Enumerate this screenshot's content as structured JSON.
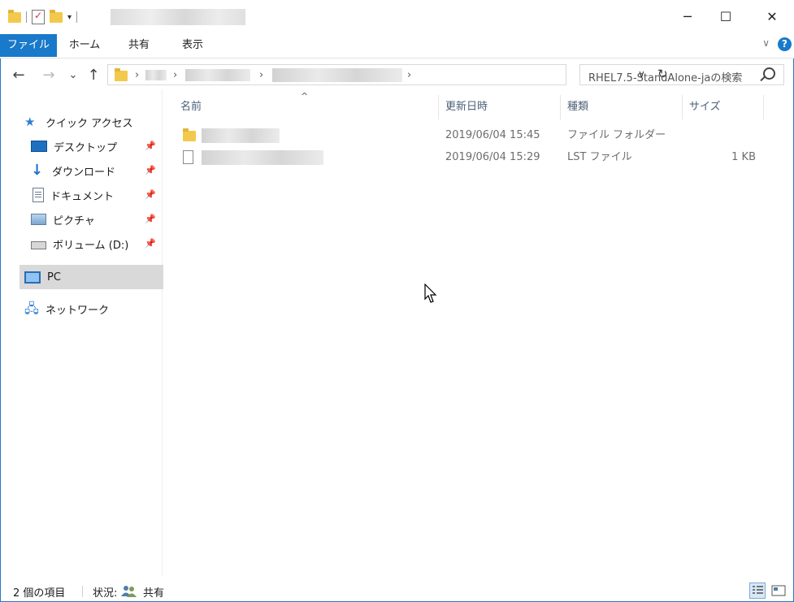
{
  "title_bar": {
    "quick_access_dropdown": "▾",
    "minimize_glyph": "─",
    "maximize_glyph": "☐",
    "close_glyph": "✕"
  },
  "ribbon": {
    "tabs": [
      {
        "label": "ファイル",
        "active": true
      },
      {
        "label": "ホーム",
        "active": false
      },
      {
        "label": "共有",
        "active": false
      },
      {
        "label": "表示",
        "active": false
      }
    ],
    "expand_glyph": "∨",
    "help_glyph": "?"
  },
  "navigation": {
    "back_glyph": "←",
    "forward_glyph": "→",
    "recent_glyph": "⌄",
    "up_glyph": "↑",
    "breadcrumb_chevron": "›",
    "address_dropdown_glyph": "∨",
    "refresh_glyph": "↻",
    "search_placeholder": "RHEL7.5-StandAlone-jaの検索"
  },
  "sidebar": {
    "quick_access_label": "クイック アクセス",
    "pinned_items": [
      {
        "label": "デスクトップ",
        "icon": "desktop-icon"
      },
      {
        "label": "ダウンロード",
        "icon": "download-icon"
      },
      {
        "label": "ドキュメント",
        "icon": "documents-icon"
      },
      {
        "label": "ピクチャ",
        "icon": "pictures-icon"
      },
      {
        "label": "ボリューム (D:)",
        "icon": "drive-icon"
      }
    ],
    "pin_glyph": "📌",
    "pc_label": "PC",
    "network_label": "ネットワーク"
  },
  "columns": {
    "name": "名前",
    "date": "更新日時",
    "type": "種類",
    "size": "サイズ",
    "sort_glyph": "^"
  },
  "files": [
    {
      "date": "2019/06/04 15:45",
      "type": "ファイル フォルダー",
      "size": "",
      "icon": "folder-icon"
    },
    {
      "date": "2019/06/04 15:29",
      "type": "LST ファイル",
      "size": "1 KB",
      "icon": "file-icon"
    }
  ],
  "status": {
    "item_count": "2 個の項目",
    "state_label": "状況:",
    "state_value": "共有"
  },
  "colors": {
    "accent": "#1979ca",
    "selection": "#d9d9d9",
    "header_text": "#4c607a",
    "folder": "#f3c94d"
  }
}
